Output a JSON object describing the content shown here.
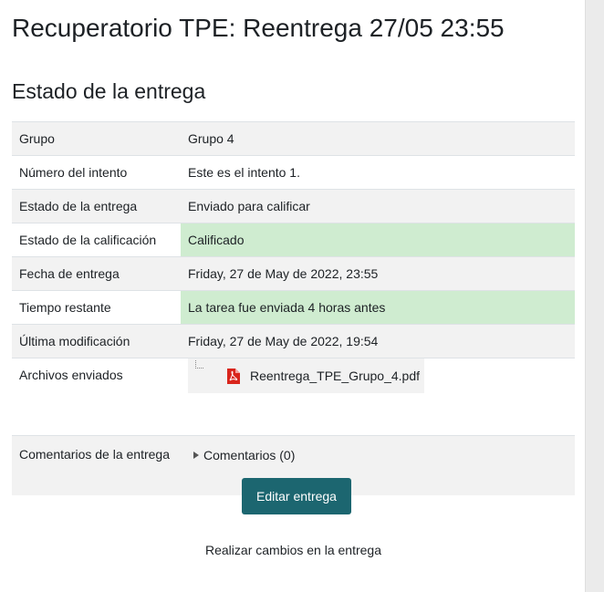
{
  "page_title": "Recuperatorio TPE: Reentrega 27/05 23:55",
  "section_title": "Estado de la entrega",
  "rows": [
    {
      "label": "Grupo",
      "value": "Grupo 4"
    },
    {
      "label": "Número del intento",
      "value": "Este es el intento 1."
    },
    {
      "label": "Estado de la entrega",
      "value": "Enviado para calificar"
    },
    {
      "label": "Estado de la calificación",
      "value": "Calificado"
    },
    {
      "label": "Fecha de entrega",
      "value": "Friday, 27 de May de 2022, 23:55"
    },
    {
      "label": "Tiempo restante",
      "value": "La tarea fue enviada 4 horas antes"
    },
    {
      "label": "Última modificación",
      "value": "Friday, 27 de May de 2022, 19:54"
    }
  ],
  "files": {
    "label": "Archivos enviados",
    "file_name": "Reentrega_TPE_Grupo_4.pdf",
    "icon": "pdf-icon"
  },
  "comments": {
    "label": "Comentarios de la entrega",
    "toggle_label": "Comentarios (0)",
    "icon": "caret-right-icon"
  },
  "actions": {
    "edit_label": "Editar entrega",
    "edit_hint": "Realizar cambios en la entrega"
  },
  "colors": {
    "success_bg": "#cfecd0",
    "button_bg": "#1c6670",
    "pdf_red": "#d9251c"
  }
}
